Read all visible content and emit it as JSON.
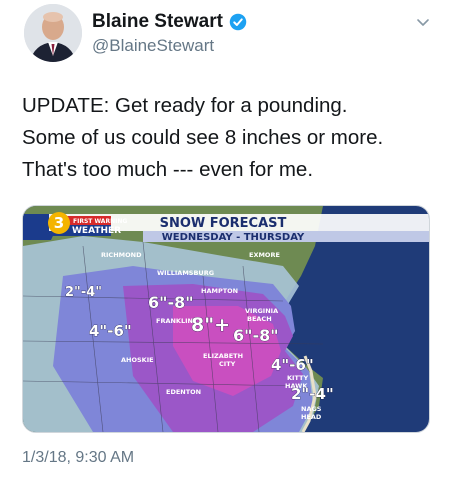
{
  "author": {
    "display_name": "Blaine Stewart",
    "handle": "@BlaineStewart",
    "verified": true,
    "verified_icon": "verified-badge-icon",
    "menu_icon": "chevron-down-icon"
  },
  "tweet": {
    "lines": [
      "UPDATE: Get ready for a pounding.",
      "Some of us could see 8 inches or more.",
      "That's too much --- even for me."
    ],
    "timestamp": "1/3/18, 9:30 AM"
  },
  "media": {
    "logo_number": "3",
    "logo_top": "FIRST WARNING",
    "logo_bottom": "WEATHER",
    "title": "SNOW FORECAST",
    "subtitle": "WEDNESDAY - THURSDAY",
    "places": {
      "richmond": "RICHMOND",
      "exmore": "EXMORE",
      "williamsburg": "WILLIAMSBURG",
      "hampton": "HAMPTON",
      "franklin": "FRANKLIN",
      "virginia_beach_1": "VIRGINIA",
      "virginia_beach_2": "BEACH",
      "ahoskie": "AHOSKIE",
      "elizabeth_city_1": "ELIZABETH",
      "elizabeth_city_2": "CITY",
      "edenton": "EDENTON",
      "kitty_hawk_1": "KITTY",
      "kitty_hawk_2": "HAWK",
      "nags_head_1": "NAGS",
      "nags_head_2": "HEAD"
    },
    "amounts": {
      "west": "2\"-4\"",
      "central": "6\"-8\"",
      "southwest": "4\"-6\"",
      "core": "8\"+",
      "beach": "6\"-8\"",
      "obx_north": "4\"-6\"",
      "obx_south": "2\"-4\""
    },
    "colors": {
      "ocean": "#1f3b78",
      "band_light": "#a9c4d8",
      "band_mid": "#7f86d8",
      "band_heavy": "#9b57c8",
      "band_core": "#c94fc0",
      "banner": "#ffffff",
      "subtitle_bar": "#bfc8e6"
    }
  }
}
